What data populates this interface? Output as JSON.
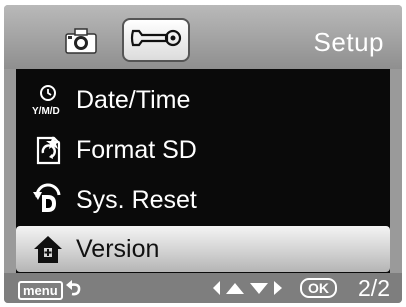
{
  "header": {
    "title": "Setup",
    "tabs": [
      {
        "name": "camera",
        "icon": "camera-icon",
        "active": false
      },
      {
        "name": "setup",
        "icon": "wrench-icon",
        "active": true
      }
    ]
  },
  "menu": {
    "items": [
      {
        "label": "Date/Time",
        "icon": "calendar-clock-icon",
        "icon_text": "Y/M/D",
        "selected": false
      },
      {
        "label": "Format SD",
        "icon": "format-sd-icon",
        "selected": false
      },
      {
        "label": "Sys. Reset",
        "icon": "reset-icon",
        "selected": false
      },
      {
        "label": "Version",
        "icon": "house-icon",
        "selected": true
      }
    ]
  },
  "footer": {
    "menu_label": "menu",
    "ok_label": "OK",
    "page": "2/2"
  },
  "colors": {
    "frame": "#9a9a9a",
    "menu_background": "#0a0a0a",
    "selected_background": "#d8d8d8",
    "text": "#ffffff"
  }
}
